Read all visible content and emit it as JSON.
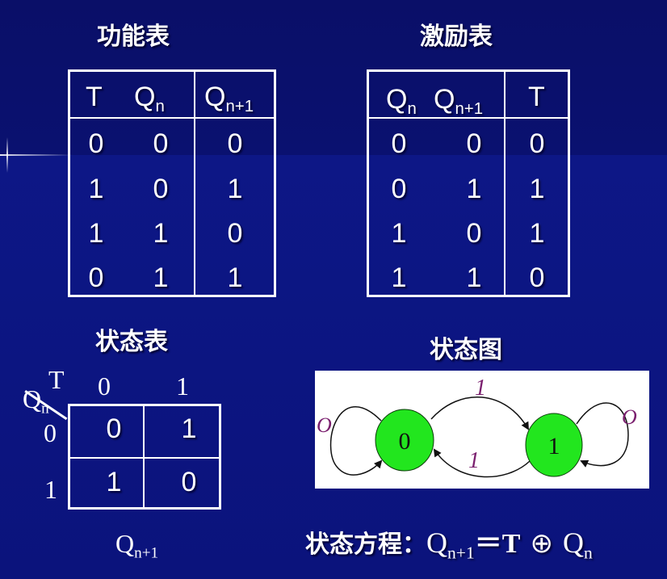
{
  "titles": {
    "function_table": "功能表",
    "excitation_table": "激励表",
    "state_table": "状态表",
    "state_diagram": "状态图"
  },
  "function_table": {
    "headers": [
      "T",
      "Q",
      "n",
      "Q",
      "n+1"
    ],
    "rows": [
      [
        "0",
        "0",
        "0"
      ],
      [
        "1",
        "0",
        "1"
      ],
      [
        "1",
        "1",
        "0"
      ],
      [
        "0",
        "1",
        "1"
      ]
    ]
  },
  "excitation_table": {
    "headers": [
      "Q",
      "n",
      "Q",
      "n+1",
      "T"
    ],
    "rows": [
      [
        "0",
        "0",
        "0"
      ],
      [
        "0",
        "1",
        "1"
      ],
      [
        "1",
        "0",
        "1"
      ],
      [
        "1",
        "1",
        "0"
      ]
    ]
  },
  "state_table": {
    "corner_top": "T",
    "corner_left": "Q",
    "corner_left_sub": "n",
    "col_headers": [
      "0",
      "1"
    ],
    "row_headers": [
      "0",
      "1"
    ],
    "cells": [
      [
        "0",
        "1"
      ],
      [
        "1",
        "0"
      ]
    ],
    "footer": "Q",
    "footer_sub": "n+1"
  },
  "state_diagram": {
    "states": [
      "0",
      "1"
    ],
    "labels": {
      "self_loop_0": "O",
      "edge_0_to_1": "1",
      "edge_1_to_0": "1",
      "self_loop_1": "O"
    },
    "node_color": "#22e61e",
    "label_color": "#7a1f6e"
  },
  "equation": {
    "prefix": "状态方程：",
    "lhs": "Q",
    "lhs_sub": "n+1",
    "equals": "＝",
    "t": "T",
    "xor": "⊕",
    "rhs": "Q",
    "rhs_sub": "n"
  }
}
